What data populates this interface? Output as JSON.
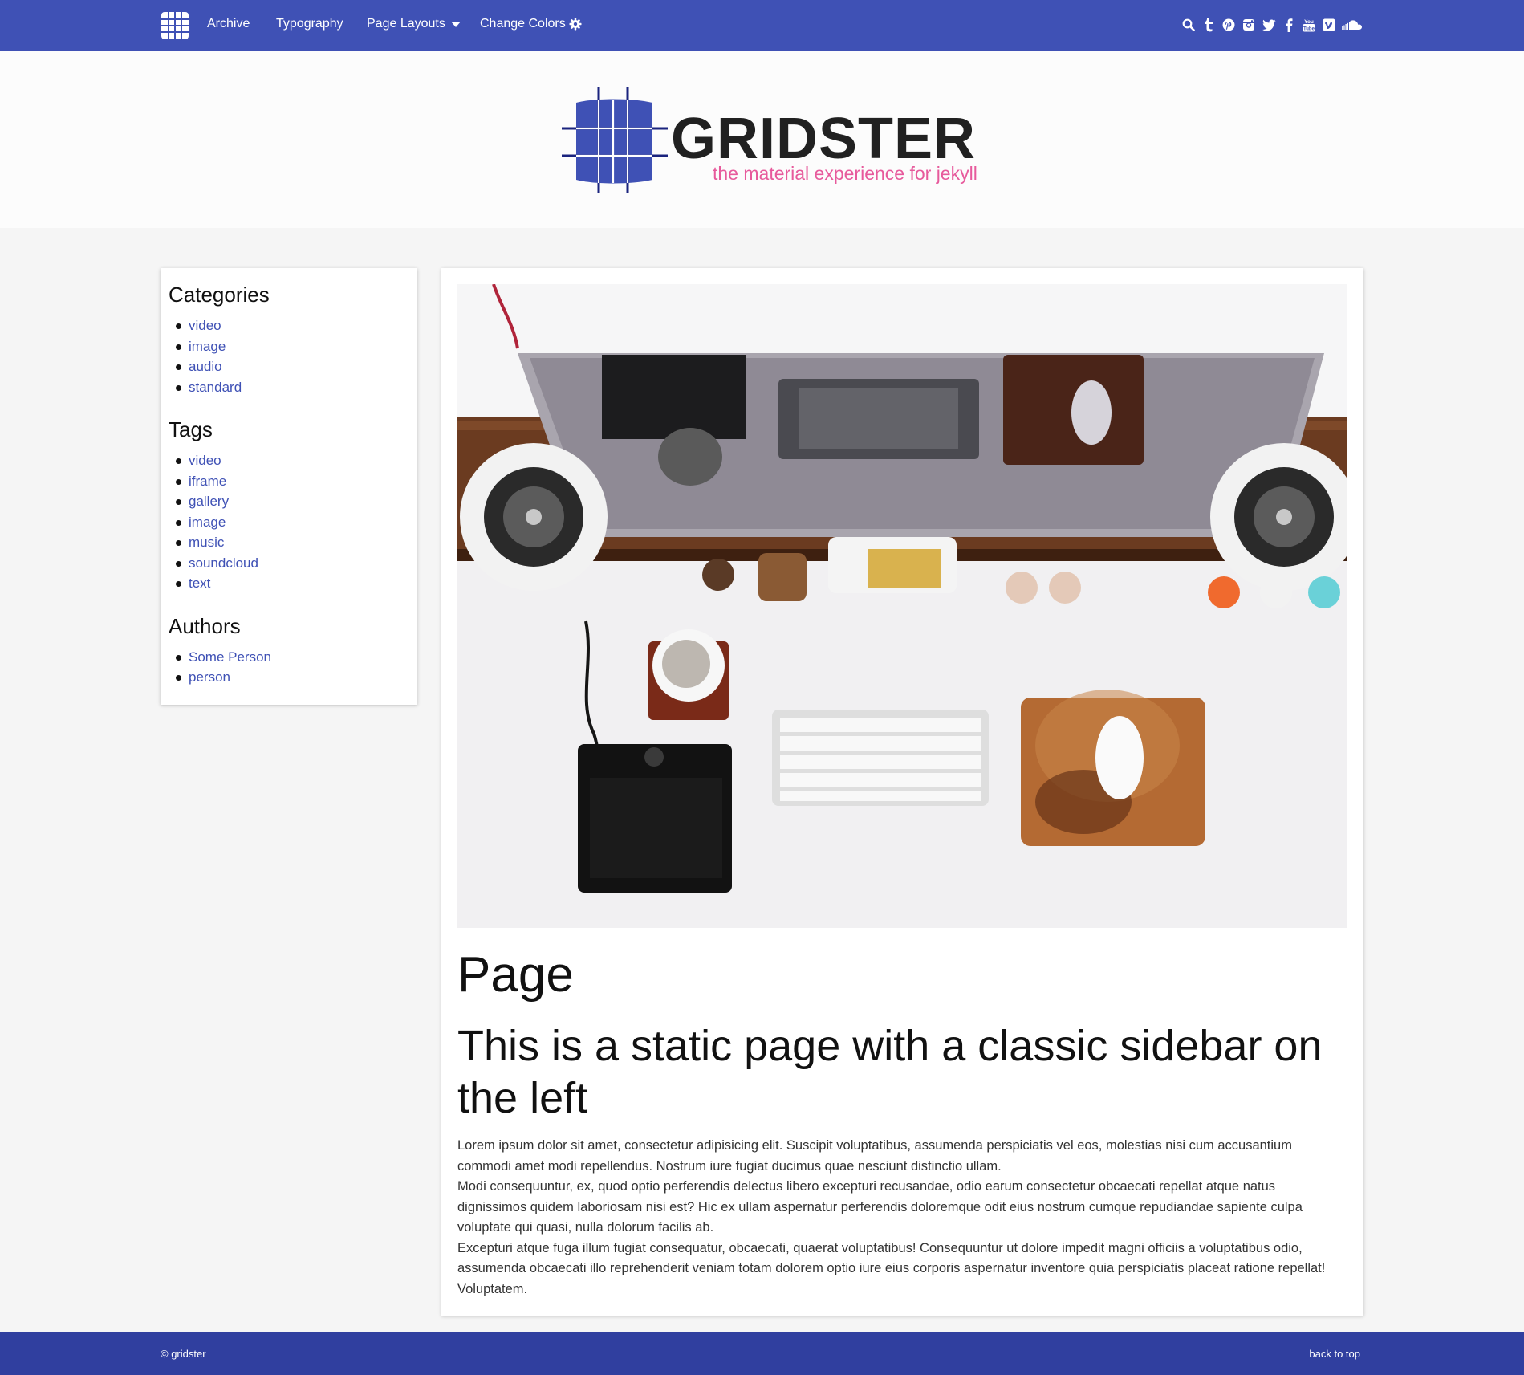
{
  "nav": {
    "links": {
      "archive": "Archive",
      "typography": "Typography",
      "page_layouts": "Page Layouts",
      "change_colors": "Change Colors"
    },
    "social_icons": [
      "search-icon",
      "tumblr-icon",
      "pinterest-icon",
      "instagram-icon",
      "twitter-icon",
      "facebook-icon",
      "youtube-icon",
      "vimeo-icon",
      "soundcloud-icon"
    ]
  },
  "header": {
    "brand_title": "GRIDSTER",
    "brand_tagline": "the material experience for jekyll"
  },
  "sidebar": {
    "categories_heading": "Categories",
    "categories": [
      "video",
      "image",
      "audio",
      "standard"
    ],
    "tags_heading": "Tags",
    "tags": [
      "video",
      "iframe",
      "gallery",
      "image",
      "music",
      "soundcloud",
      "text"
    ],
    "authors_heading": "Authors",
    "authors": [
      "Some Person",
      "person"
    ]
  },
  "main": {
    "title": "Page",
    "subtitle": "This is a static page with a classic sidebar on the left",
    "paragraphs": [
      "Lorem ipsum dolor sit amet, consectetur adipisicing elit. Suscipit voluptatibus, assumenda perspiciatis vel eos, molestias nisi cum accusantium commodi amet modi repellendus. Nostrum iure fugiat ducimus quae nesciunt distinctio ullam.",
      "Modi consequuntur, ex, quod optio perferendis delectus libero excepturi recusandae, odio earum consectetur obcaecati repellat atque natus dignissimos quidem laboriosam nisi est? Hic ex ullam aspernatur perferendis doloremque odit eius nostrum cumque repudiandae sapiente culpa voluptate qui quasi, nulla dolorum facilis ab.",
      "Excepturi atque fuga illum fugiat consequatur, obcaecati, quaerat voluptatibus! Consequuntur ut dolore impedit magni officiis a voluptatibus odio, assumenda obcaecati illo reprehenderit veniam totam dolorem optio iure eius corporis aspernatur inventore quia perspiciatis placeat ratione repellat! Voluptatem."
    ]
  },
  "footer": {
    "copyright": "© gridster",
    "back_to_top": "back to top"
  },
  "colors": {
    "primary": "#3f51b5",
    "primary_dark": "#303f9f",
    "accent": "#e75a9c",
    "background": "#f5f5f5"
  }
}
